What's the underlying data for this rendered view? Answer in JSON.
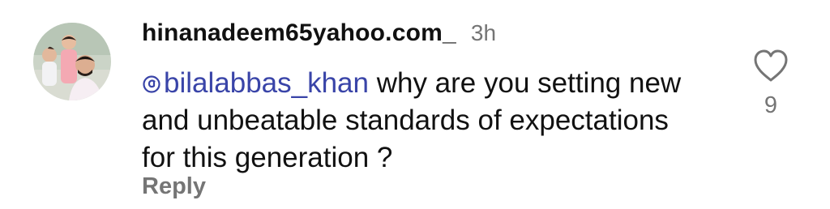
{
  "comment": {
    "username": "hinanadeem65yahoo.com_",
    "timestamp": "3h",
    "mention": "bilalabbas_khan",
    "text": " why are you setting new and unbeatable standards of expectations for this generation ?",
    "reply_label": "Reply",
    "like_count": "9"
  },
  "icons": {
    "avatar": "user-avatar-photo",
    "mention": "threads-at-icon",
    "like": "heart-outline-icon"
  },
  "colors": {
    "mention": "#3944a8",
    "secondary_text": "#757575",
    "primary_text": "#111111"
  }
}
